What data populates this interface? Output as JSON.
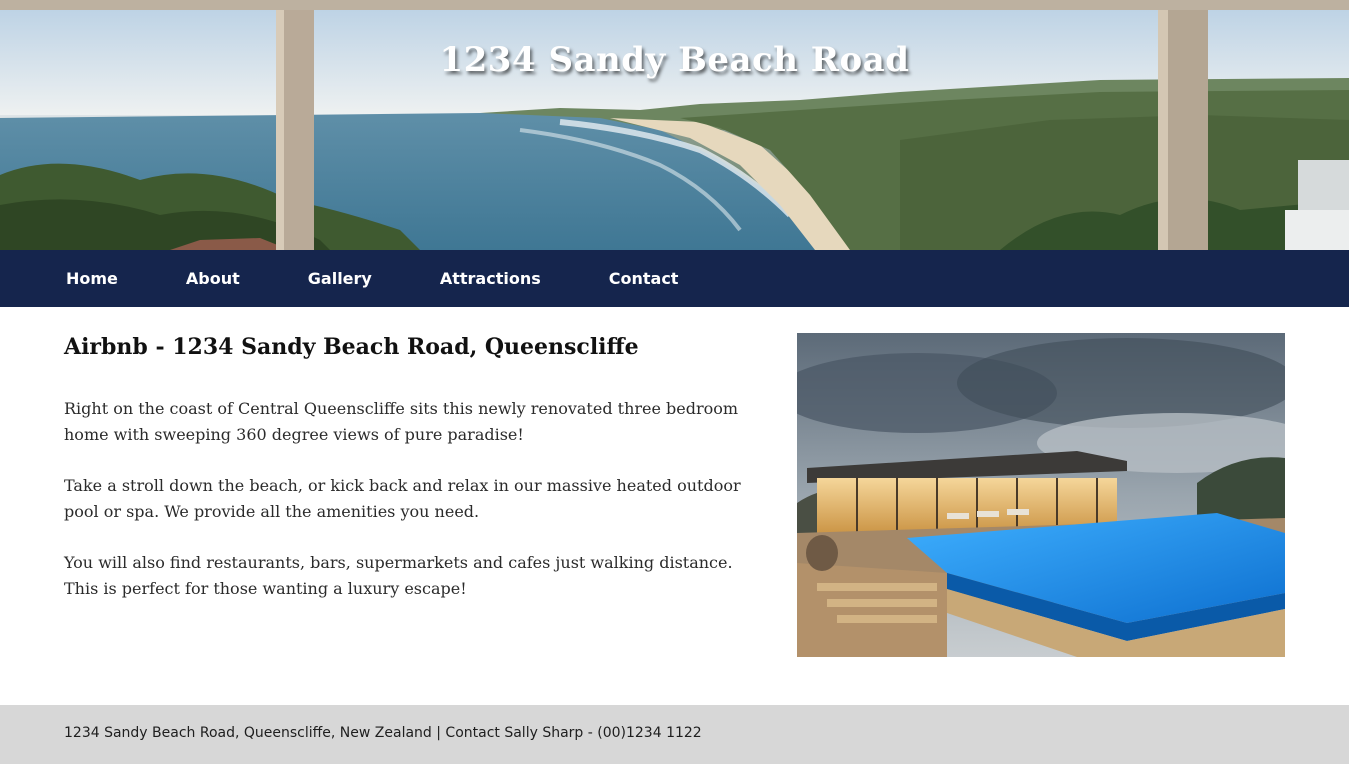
{
  "hero": {
    "title": "1234 Sandy Beach Road"
  },
  "nav": {
    "items": [
      "Home",
      "About",
      "Gallery",
      "Attractions",
      "Contact"
    ]
  },
  "main": {
    "heading": "Airbnb - 1234 Sandy Beach Road, Queenscliffe",
    "paragraphs": [
      "Right on the coast of Central Queenscliffe sits this newly renovated three bedroom home with sweeping 360 degree views of pure paradise!",
      "Take a stroll down the beach, or kick back and relax in our massive heated outdoor pool or spa. We provide all the amenities you need.",
      "You will also find restaurants, bars, supermarkets and cafes just walking distance. This is perfect for those wanting a luxury escape!"
    ]
  },
  "footer": {
    "text": "1234 Sandy Beach Road, Queenscliffe, New Zealand | Contact Sally Sharp - (00)1234 1122"
  },
  "colors": {
    "nav_bg": "#15254d",
    "nav_text": "#ffffff",
    "footer_bg": "#d7d7d7",
    "pool_blue": "#1f8fe0"
  }
}
